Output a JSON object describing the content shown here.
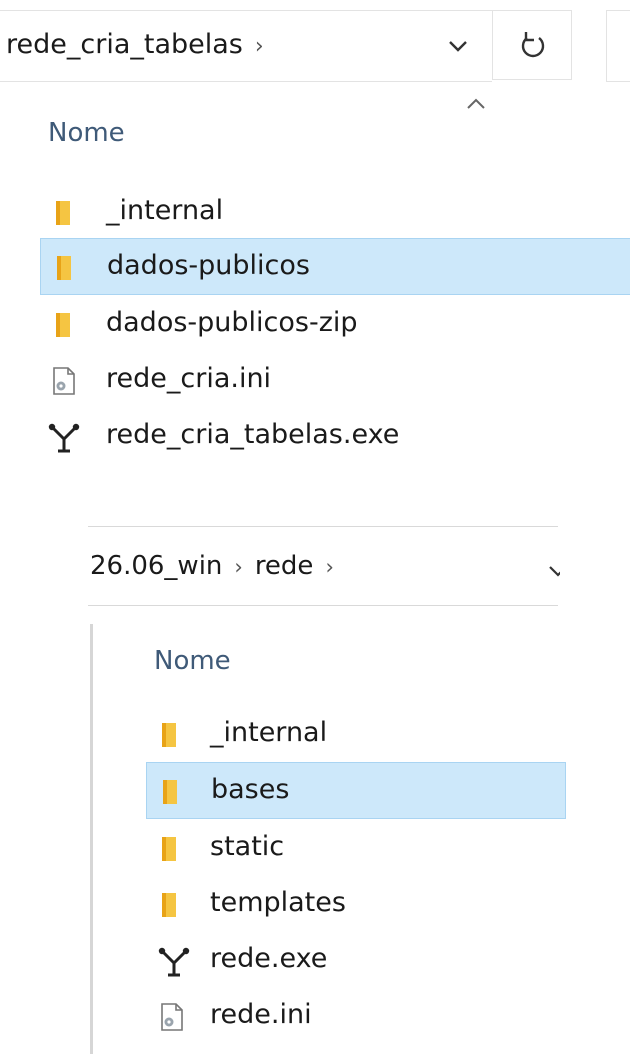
{
  "panel1": {
    "breadcrumb": [
      "rede_cria_tabelas"
    ],
    "breadcrumb_sep": "›",
    "column_header": "Nome",
    "items": [
      {
        "label": "_internal",
        "icon": "folder-icon",
        "selected": false
      },
      {
        "label": "dados-publicos",
        "icon": "folder-icon",
        "selected": true
      },
      {
        "label": "dados-publicos-zip",
        "icon": "folder-icon",
        "selected": false
      },
      {
        "label": "rede_cria.ini",
        "icon": "settings-file-icon",
        "selected": false
      },
      {
        "label": "rede_cria_tabelas.exe",
        "icon": "network-exe-icon",
        "selected": false
      }
    ]
  },
  "panel2": {
    "breadcrumb": [
      "26.06_win",
      "rede"
    ],
    "breadcrumb_sep": "›",
    "column_header": "Nome",
    "items": [
      {
        "label": "_internal",
        "icon": "folder-icon",
        "selected": false
      },
      {
        "label": "bases",
        "icon": "folder-icon",
        "selected": true
      },
      {
        "label": "static",
        "icon": "folder-icon",
        "selected": false
      },
      {
        "label": "templates",
        "icon": "folder-icon",
        "selected": false
      },
      {
        "label": "rede.exe",
        "icon": "network-exe-icon",
        "selected": false
      },
      {
        "label": "rede.ini",
        "icon": "settings-file-icon",
        "selected": false
      }
    ]
  },
  "colors": {
    "selection_bg": "#cde8fa",
    "selection_border": "#a9d4f2",
    "folder_yellow": "#f5c542",
    "header_text": "#3f5a78"
  }
}
